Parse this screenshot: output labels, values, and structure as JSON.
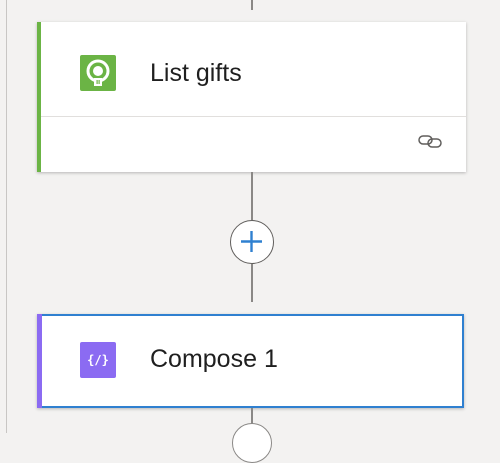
{
  "flow": {
    "steps": [
      {
        "title": "List gifts",
        "icon": "gift-connector-icon",
        "accent_color": "#6bb445",
        "icon_color": "#6bb445",
        "footer_icon": "link-icon"
      },
      {
        "title": "Compose 1",
        "icon": "compose-braces-icon",
        "icon_glyph": "{/}",
        "accent_color": "#8b6bf2",
        "icon_color": "#8b6bf2",
        "selected": true,
        "selection_color": "#2f80d0"
      }
    ],
    "add_step_icon": "plus-icon",
    "connector_color": "#8a8886",
    "plus_color": "#2f80d0"
  }
}
